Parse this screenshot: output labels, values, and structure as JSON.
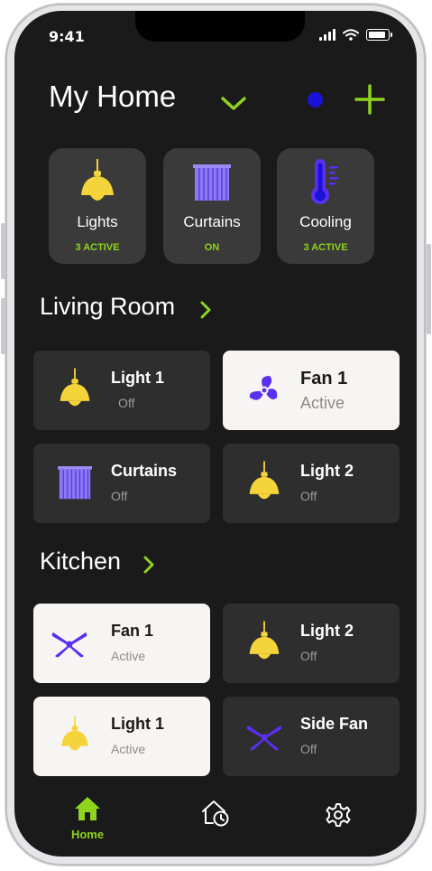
{
  "status": {
    "time": "9:41"
  },
  "header": {
    "title": "My Home"
  },
  "categories": [
    {
      "name": "Lights",
      "sub": "3 ACTIVE",
      "icon": "pendant-lamp-icon"
    },
    {
      "name": "Curtains",
      "sub": "ON",
      "icon": "curtains-icon"
    },
    {
      "name": "Cooling",
      "sub": "3 ACTIVE",
      "icon": "thermometer-icon"
    }
  ],
  "living_room": {
    "title": "Living Room",
    "devices": [
      {
        "name": "Light 1",
        "status": "Off",
        "icon": "pendant-lamp-icon"
      },
      {
        "name": "Fan 1",
        "status": "Active",
        "icon": "fan-icon"
      },
      {
        "name": "Curtains",
        "status": "Off",
        "icon": "curtains-icon"
      },
      {
        "name": "Light 2",
        "status": "Off",
        "icon": "pendant-lamp-icon"
      }
    ]
  },
  "kitchen": {
    "title": "Kitchen",
    "devices": [
      {
        "name": "Fan 1",
        "status": "Active",
        "icon": "ceiling-fan-icon"
      },
      {
        "name": "Light 2",
        "status": "Off",
        "icon": "pendant-lamp-icon"
      },
      {
        "name": "Light 1",
        "status": "Active",
        "icon": "pendant-lamp-icon"
      },
      {
        "name": "Side Fan",
        "status": "Off",
        "icon": "ceiling-fan-icon"
      }
    ]
  },
  "tabbar": {
    "home_label": "Home"
  },
  "colors": {
    "accent": "#8fd31c",
    "lamp": "#f5d33a",
    "purple": "#6b3cf0",
    "blue_dot": "#1b12d9",
    "card": "#3a3a3a",
    "tile": "#2e2e2e",
    "active_tile": "#f7f5f3"
  }
}
